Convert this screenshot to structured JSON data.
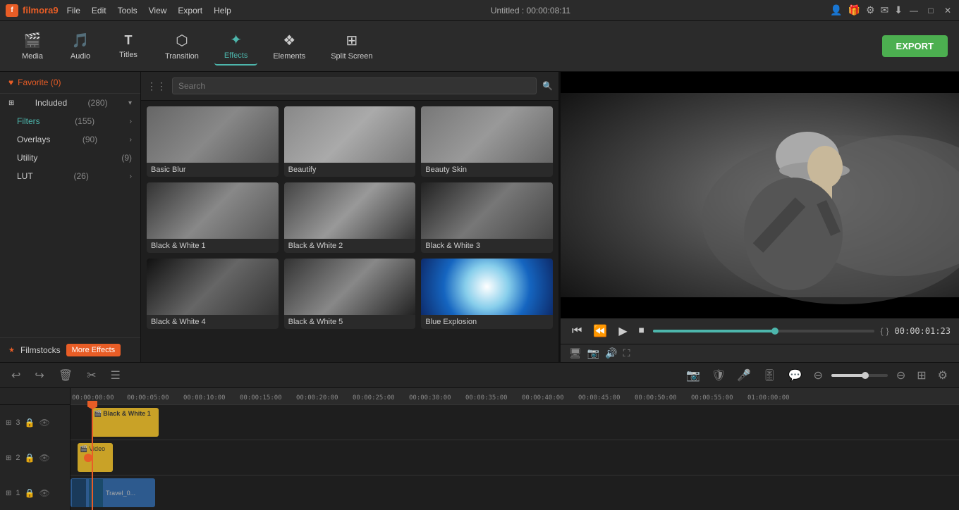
{
  "titlebar": {
    "logo": "filmora9",
    "logo_letter": "f",
    "menus": [
      "File",
      "Edit",
      "Tools",
      "View",
      "Export",
      "Help"
    ],
    "title": "Untitled : 00:00:08:11",
    "icons": [
      "user-icon",
      "gift-icon",
      "settings-icon",
      "message-icon",
      "download-icon"
    ],
    "win_btns": [
      "minimize-btn",
      "maximize-btn",
      "close-btn"
    ],
    "win_symbols": [
      "—",
      "□",
      "✕"
    ]
  },
  "toolbar": {
    "items": [
      {
        "id": "media",
        "icon": "🎬",
        "label": "Media"
      },
      {
        "id": "audio",
        "icon": "🎵",
        "label": "Audio"
      },
      {
        "id": "titles",
        "icon": "T",
        "label": "Titles"
      },
      {
        "id": "transition",
        "icon": "⬡",
        "label": "Transition"
      },
      {
        "id": "effects",
        "icon": "✦",
        "label": "Effects"
      },
      {
        "id": "elements",
        "icon": "❖",
        "label": "Elements"
      },
      {
        "id": "splitscreen",
        "icon": "⊞",
        "label": "Split Screen"
      }
    ],
    "active": "effects",
    "export_label": "EXPORT"
  },
  "left_panel": {
    "favorite": "Favorite (0)",
    "groups": [
      {
        "label": "Included",
        "count": "(280)",
        "chevron": "▾",
        "active": false
      },
      {
        "label": "Filters",
        "count": "(155)",
        "chevron": "›",
        "active": true
      },
      {
        "label": "Overlays",
        "count": "(90)",
        "chevron": "›",
        "active": false
      },
      {
        "label": "Utility",
        "count": "(9)",
        "chevron": "",
        "active": false
      },
      {
        "label": "LUT",
        "count": "(26)",
        "chevron": "›",
        "active": false
      }
    ],
    "filmstocks_label": "Filmstocks",
    "more_effects_label": "More Effects"
  },
  "effects_panel": {
    "search_placeholder": "Search",
    "effects": [
      {
        "id": "basic-blur",
        "label": "Basic Blur",
        "thumb_class": "thumb-basic-blur"
      },
      {
        "id": "beautify",
        "label": "Beautify",
        "thumb_class": "thumb-beautify"
      },
      {
        "id": "beauty-skin",
        "label": "Beauty Skin",
        "thumb_class": "thumb-beauty-skin"
      },
      {
        "id": "bw1",
        "label": "Black & White 1",
        "thumb_class": "thumb-bw1"
      },
      {
        "id": "bw2",
        "label": "Black & White 2",
        "thumb_class": "thumb-bw2"
      },
      {
        "id": "bw3",
        "label": "Black & White 3",
        "thumb_class": "thumb-bw3"
      },
      {
        "id": "bw4",
        "label": "Black & White 4",
        "thumb_class": "thumb-bw4"
      },
      {
        "id": "bw5",
        "label": "Black & White 5",
        "thumb_class": "thumb-bw5"
      },
      {
        "id": "blue-explosion",
        "label": "Blue Explosion",
        "thumb_class": "thumb-blue-explosion"
      }
    ]
  },
  "preview": {
    "timecode": "00:00:01:23",
    "progress_pct": 55,
    "controls": [
      "⏮",
      "⏪",
      "▶",
      "⏹"
    ],
    "bracket_left": "{",
    "bracket_right": "}"
  },
  "timeline": {
    "toolbar_btns": [
      "↩",
      "↪",
      "🗑",
      "✂",
      "☰"
    ],
    "ruler_marks": [
      "00:00:00:00",
      "00:00:05:00",
      "00:00:10:00",
      "00:00:15:00",
      "00:00:20:00",
      "00:00:25:00",
      "00:00:30:00",
      "00:00:35:00",
      "00:00:40:00",
      "00:00:45:00",
      "00:00:50:00",
      "00:00:55:00",
      "01:00:00:00"
    ],
    "tracks": [
      {
        "num": "3",
        "clip_label": "Black & White 1",
        "clip_type": "effect"
      },
      {
        "num": "2",
        "clip_label": "Video",
        "clip_type": "video"
      },
      {
        "num": "1",
        "clip_label": "Travel_0...",
        "clip_type": "main"
      }
    ]
  }
}
